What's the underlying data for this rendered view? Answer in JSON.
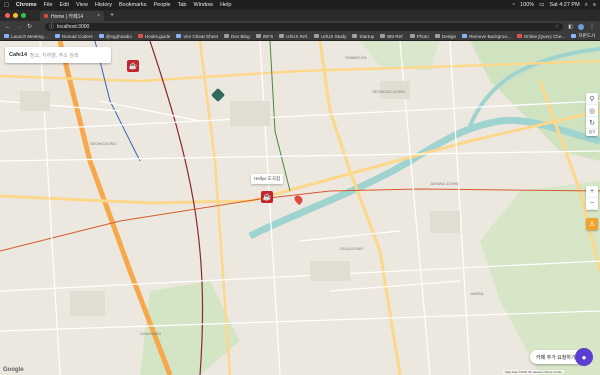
{
  "menubar": {
    "items": [
      "Chrome",
      "File",
      "Edit",
      "View",
      "History",
      "Bookmarks",
      "People",
      "Tab",
      "Window",
      "Help"
    ],
    "battery": "100%",
    "clock": "Sat 4:27 PM"
  },
  "tab": {
    "title": "Home | 카페14"
  },
  "address": {
    "url": "localhost:3000"
  },
  "bookmarks": [
    {
      "label": "Launch Meeting ..."
    },
    {
      "label": "Nomad Coders"
    },
    {
      "label": "@eggheadio"
    },
    {
      "label": "Hooks.guide"
    },
    {
      "label": "Vim Cheat Sheet"
    },
    {
      "label": "Dev Blog"
    },
    {
      "label": "INFS"
    },
    {
      "label": "UI/UX Ref."
    },
    {
      "label": "UI/UX Study"
    },
    {
      "label": "Startup"
    },
    {
      "label": "BM Ref."
    },
    {
      "label": "Photo"
    },
    {
      "label": "Design"
    },
    {
      "label": "Remove Backgrou..."
    },
    {
      "label": "Online jQuery Che..."
    },
    {
      "label": "자판도사"
    }
  ],
  "search": {
    "logo": "Cafe14",
    "placeholder": "장소, 지하철, 주소 검색"
  },
  "controls": {
    "locate_label": "접기"
  },
  "tooltip": {
    "text": "Hellyo 도곡점"
  },
  "add_cafe": {
    "label": "카페 추가 요청하기"
  },
  "map_labels": {
    "gwangjin": "GWANGJIN",
    "seongsu": "SEONGSU-DONG",
    "jayang": "JAYANG-DONG",
    "guui": "GUUI-DONG",
    "jamsil": "JAMSIL",
    "seongdong": "SEONGDONG",
    "gangnam": "GANGNAM"
  },
  "google": "Google",
  "footer": "Map data ©2020 SK telecom Terms of Use"
}
